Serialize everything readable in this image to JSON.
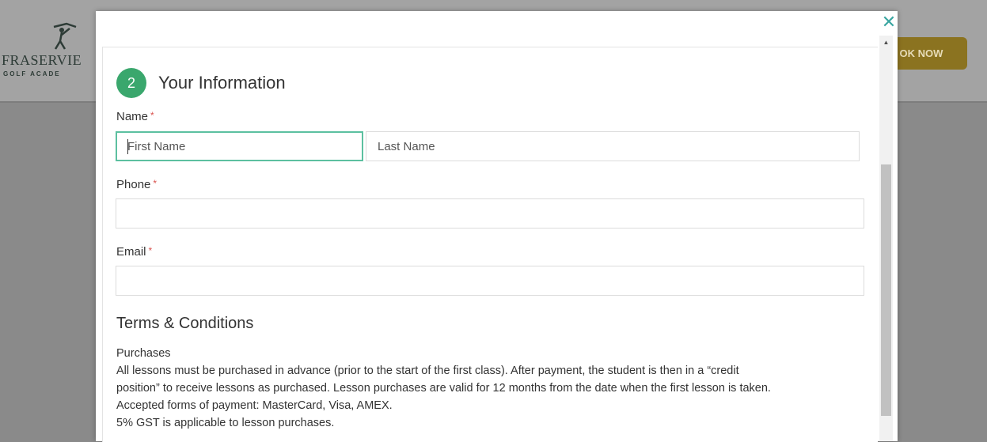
{
  "site": {
    "logo_name": "FRASERVIE",
    "logo_sub": "GOLF ACADE",
    "book_now_label": "OK NOW"
  },
  "modal": {
    "close_icon": "close-icon",
    "step_number": "2",
    "section_title": "Your Information",
    "name": {
      "label": "Name",
      "required_mark": "*",
      "first_placeholder": "First Name",
      "last_placeholder": "Last Name",
      "first_value": "",
      "last_value": ""
    },
    "phone": {
      "label": "Phone",
      "required_mark": "*",
      "value": ""
    },
    "email": {
      "label": "Email",
      "required_mark": "*",
      "value": ""
    },
    "terms": {
      "title": "Terms & Conditions",
      "lines": [
        "Purchases",
        "All lessons must be purchased in advance (prior to the start of the first class). After payment, the student is then in a “credit",
        "position” to receive lessons as purchased. Lesson purchases are valid for 12 months from the date when the first lesson is taken.",
        "Accepted forms of payment: MasterCard, Visa, AMEX.",
        "5% GST is applicable to lesson purchases."
      ]
    }
  },
  "colors": {
    "accent_green": "#3aa76d",
    "focus_border": "#5cc0a0",
    "close_icon": "#3aa6a1",
    "required_red": "#d9534f",
    "book_button": "#8b7320"
  }
}
